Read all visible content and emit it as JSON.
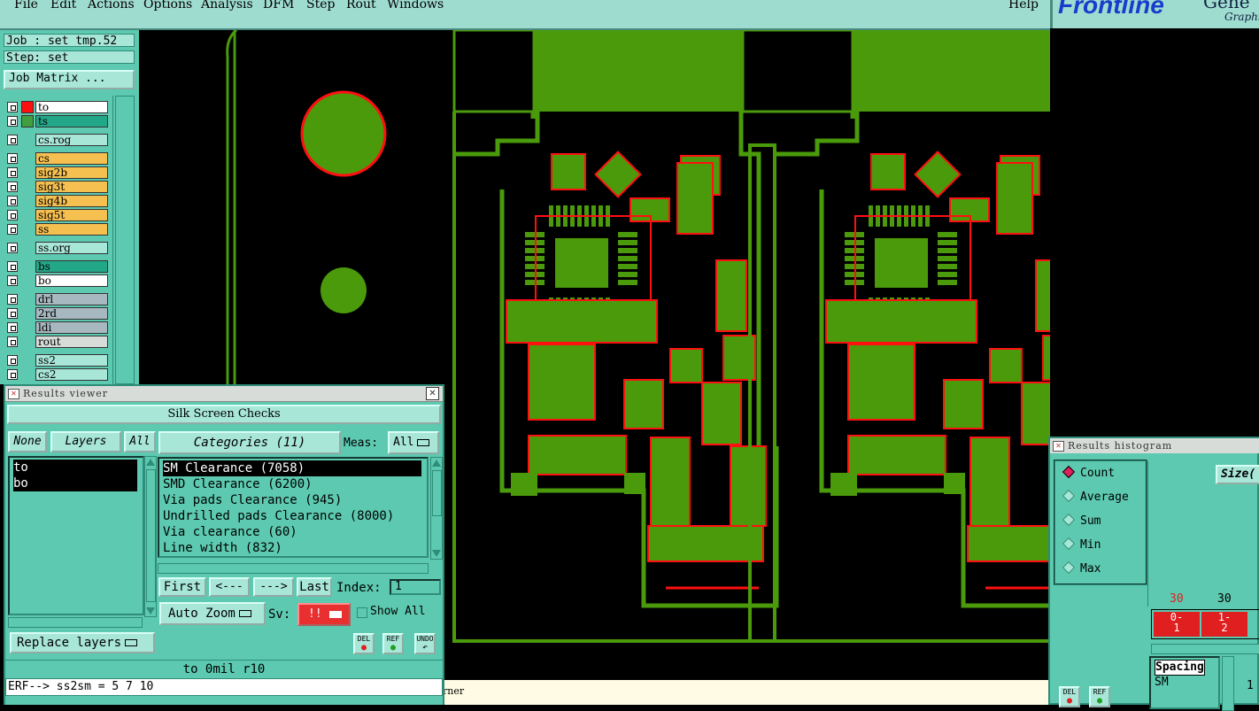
{
  "menu": {
    "items": [
      "File",
      "Edit",
      "Actions",
      "Options",
      "Analysis",
      "DFM",
      "Step",
      "Rout",
      "Windows"
    ],
    "help": "Help"
  },
  "logo": {
    "brand": "Frontline",
    "tag_a": "Gene",
    "tag_b": "Graphi"
  },
  "job": {
    "job_label": "Job : set_tmp.52",
    "step_label": "Step: set",
    "matrix_button": "Job Matrix ..."
  },
  "layers": [
    {
      "name": "to",
      "color": "#ff1010",
      "bg": "#ffffff"
    },
    {
      "name": "ts",
      "color": "#40a040",
      "bg": "#22a888"
    },
    {
      "name": "cs.rog",
      "color": "",
      "bg": "#a8e6d8"
    },
    {
      "name": "cs",
      "color": "",
      "bg": "#f6c050"
    },
    {
      "name": "sig2b",
      "color": "",
      "bg": "#f6c050"
    },
    {
      "name": "sig3t",
      "color": "",
      "bg": "#f6c050"
    },
    {
      "name": "sig4b",
      "color": "",
      "bg": "#f6c050"
    },
    {
      "name": "sig5t",
      "color": "",
      "bg": "#f6c050"
    },
    {
      "name": "ss",
      "color": "",
      "bg": "#f6c050"
    },
    {
      "name": "ss.org",
      "color": "",
      "bg": "#a8e6d8"
    },
    {
      "name": "bs",
      "color": "",
      "bg": "#22a888"
    },
    {
      "name": "bo",
      "color": "",
      "bg": "#ffffff"
    },
    {
      "name": "drl",
      "color": "",
      "bg": "#a8b8c0"
    },
    {
      "name": "2rd",
      "color": "",
      "bg": "#a8b8c0"
    },
    {
      "name": "ldi",
      "color": "",
      "bg": "#a8b8c0"
    },
    {
      "name": "rout",
      "color": "",
      "bg": "#d8dcd8"
    },
    {
      "name": "ss2",
      "color": "",
      "bg": "#a8e6d8"
    },
    {
      "name": "cs2",
      "color": "",
      "bg": "#a8e6d8"
    }
  ],
  "results_viewer": {
    "title": "Results viewer",
    "close": "✕",
    "header": "Silk Screen Checks",
    "none_btn": "None",
    "layers_btn": "Layers",
    "all_btn": "All",
    "layer_list": [
      "to",
      "bo"
    ],
    "categories_btn": "Categories (11)",
    "meas_label": "Meas:",
    "meas_value": "All",
    "categories": [
      "SM Clearance (7058)",
      "SMD Clearance (6200)",
      "Via pads Clearance (945)",
      "Undrilled pads Clearance (8000)",
      "Via clearance (60)",
      "Line width (832)"
    ],
    "first_btn": "First",
    "prev_btn": "<---",
    "next_btn": "--->",
    "last_btn": "Last",
    "index_label": "Index:",
    "index_value": "1",
    "zoom_value": "Auto Zoom",
    "sv_label": "Sv:",
    "sv_value": "!!",
    "show_all": "Show All",
    "replace_btn": "Replace layers",
    "del": "DEL",
    "ref": "REF",
    "undo": "UNDO",
    "status_line": "to 0mil  r10",
    "erf_line": "ERF--> ss2sm = 5 7 10"
  },
  "canvas_status": "rner",
  "histogram": {
    "title": "Results histogram",
    "radios": [
      "Count",
      "Average",
      "Sum",
      "Min",
      "Max"
    ],
    "selected": "Count",
    "size_btn": "Size(",
    "counts": [
      "30",
      "30"
    ],
    "bins": [
      "0-\n1",
      "1-\n2"
    ],
    "list_sel": "Spacing",
    "list_item2": "SM",
    "num": "1",
    "del": "DEL",
    "ref": "REF"
  },
  "colors": {
    "pcb_green": "#4a9a0c",
    "highlight_red": "#ff1010",
    "panel": "#5cc9b0"
  }
}
